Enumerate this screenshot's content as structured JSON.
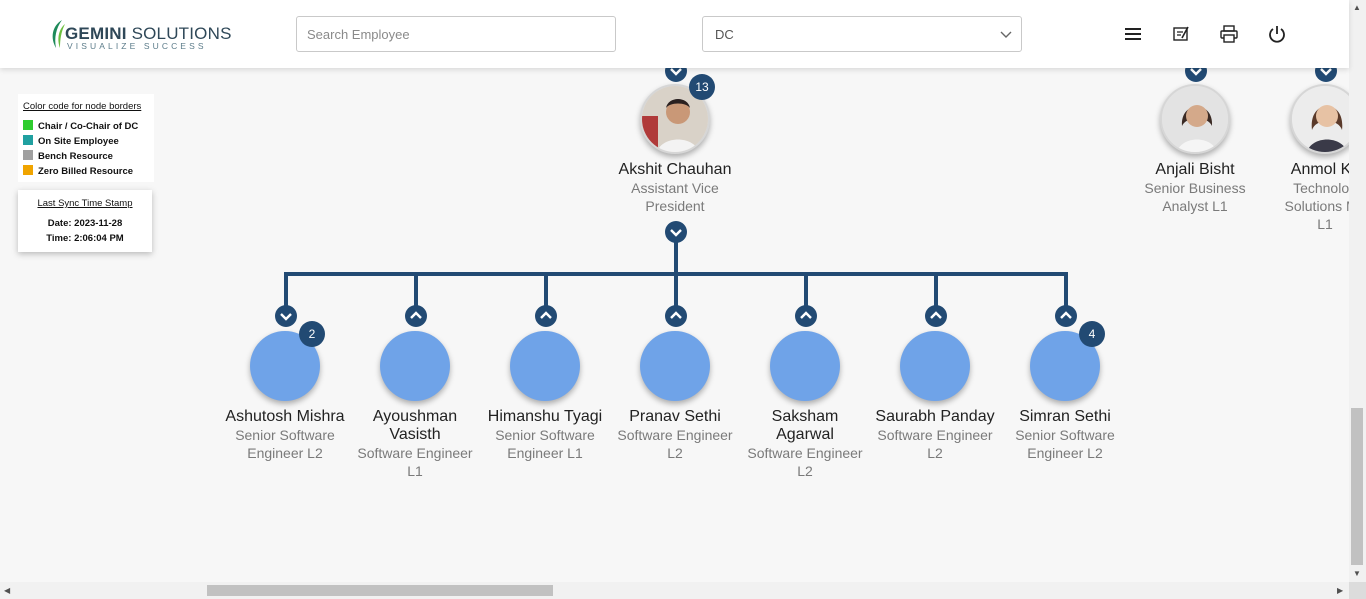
{
  "header": {
    "logo": {
      "main_bold": "GEMINI",
      "main_rest": " SOLUTIONS",
      "tagline": "VISUALIZE SUCCESS"
    },
    "search": {
      "placeholder": "Search Employee",
      "value": ""
    },
    "department_select": {
      "value": "DC"
    },
    "icons": [
      "menu-icon",
      "edit-note-icon",
      "print-icon",
      "power-icon"
    ]
  },
  "legend": {
    "title": "Color code for node borders",
    "items": [
      {
        "label": "Chair / Co-Chair of DC",
        "color": "#2ecc2e"
      },
      {
        "label": "On Site Employee",
        "color": "#20a0a0"
      },
      {
        "label": "Bench Resource",
        "color": "#a0a0a0"
      },
      {
        "label": "Zero Billed Resource",
        "color": "#f0a400"
      }
    ]
  },
  "sync": {
    "title": "Last Sync Time Stamp",
    "date": "Date: 2023-11-28",
    "time": "Time: 2:06:04 PM"
  },
  "colors": {
    "node": "#6fa3e8",
    "connector": "#224a73",
    "badge": "#224a73"
  },
  "org": {
    "focus": {
      "name": "Akshit Chauhan",
      "role_1": "Assistant Vice",
      "role_2": "President",
      "reports": "13"
    },
    "peers": [
      {
        "name": "Anjali Bisht",
        "role_1": "Senior Business",
        "role_2": "Analyst L1"
      },
      {
        "name": "Anmol Kc",
        "role_1": "Technolog",
        "role_2": "Solutions Ma",
        "role_3": "L1"
      }
    ],
    "children": [
      {
        "name": "Ashutosh Mishra",
        "role_1": "Senior Software",
        "role_2": "Engineer L2",
        "reports": "2"
      },
      {
        "name_1": "Ayoushman",
        "name_2": "Vasisth",
        "role_1": "Software Engineer",
        "role_2": "L1"
      },
      {
        "name": "Himanshu Tyagi",
        "role_1": "Senior Software",
        "role_2": "Engineer L1"
      },
      {
        "name": "Pranav Sethi",
        "role_1": "Software Engineer",
        "role_2": "L2"
      },
      {
        "name_1": "Saksham",
        "name_2": "Agarwal",
        "role_1": "Software Engineer",
        "role_2": "L2"
      },
      {
        "name": "Saurabh Panday",
        "role_1": "Software Engineer",
        "role_2": "L2"
      },
      {
        "name": "Simran Sethi",
        "role_1": "Senior Software",
        "role_2": "Engineer L2",
        "reports": "4"
      }
    ]
  }
}
